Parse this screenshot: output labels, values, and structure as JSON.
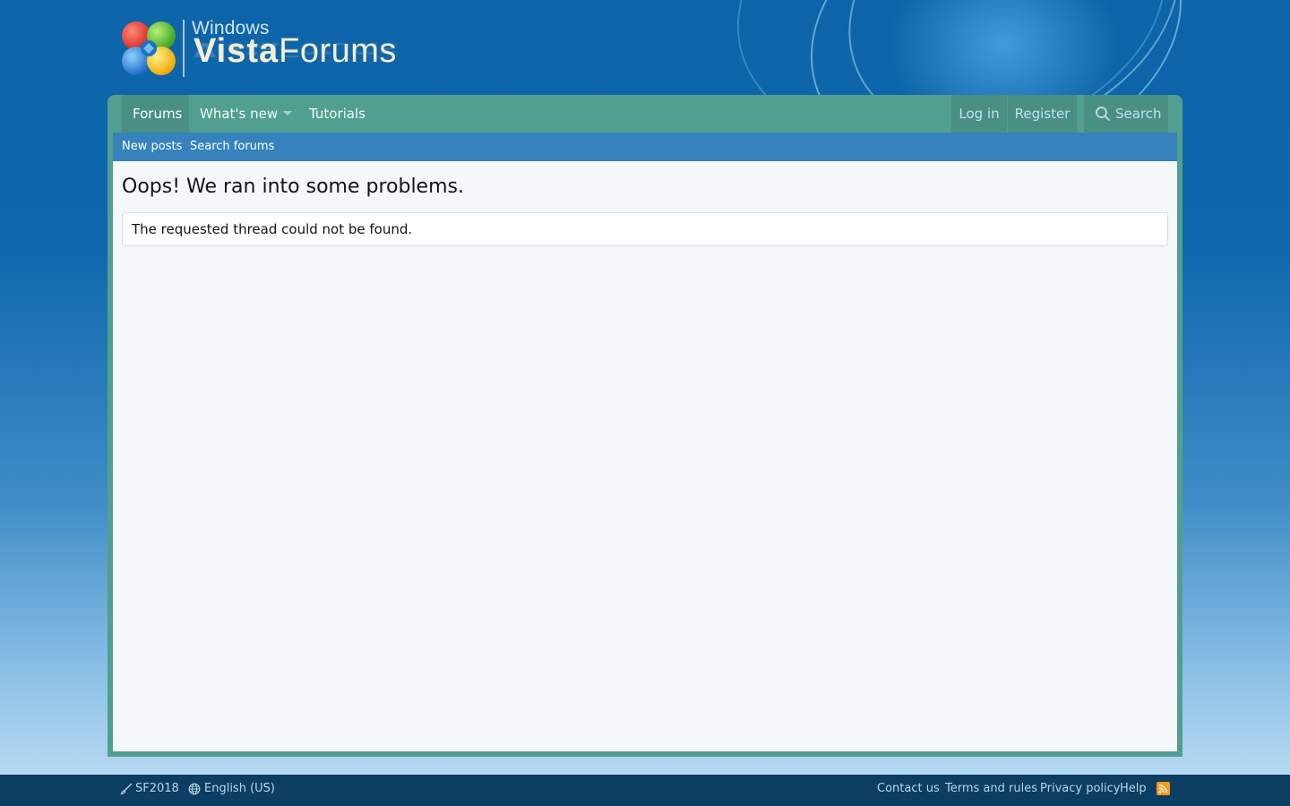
{
  "logo": {
    "small_text": "Windows",
    "bold_text": "Vista",
    "light_text": "Forums"
  },
  "nav": {
    "forums": "Forums",
    "whats_new": "What's new",
    "tutorials": "Tutorials",
    "login": "Log in",
    "register": "Register",
    "search": "Search"
  },
  "subnav": {
    "new_posts": "New posts",
    "search_forums": "Search forums"
  },
  "main": {
    "title": "Oops! We ran into some problems.",
    "error_message": "The requested thread could not be found."
  },
  "footer": {
    "style": "SF2018",
    "language": "English (US)",
    "links": [
      "Contact us",
      "Terms and rules",
      "Privacy policy",
      "Help"
    ]
  },
  "colors": {
    "nav_bar": "#519f90",
    "subnav": "#3582bd",
    "footer": "#0c3d63",
    "rss": "#f39a1d"
  },
  "icons": [
    "search-icon",
    "brush-icon",
    "globe-icon",
    "rss-icon",
    "windows-flag-icon",
    "dropdown-caret-icon"
  ]
}
